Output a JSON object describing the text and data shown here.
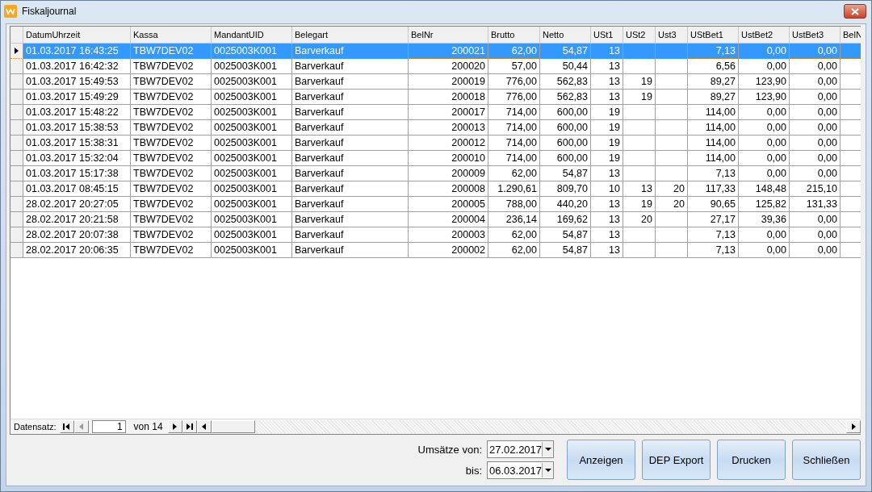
{
  "window": {
    "title": "Fiskaljournal"
  },
  "table": {
    "columns": [
      "DatumUhrzeit",
      "Kassa",
      "MandantUID",
      "Belegart",
      "BelNr",
      "Brutto",
      "Netto",
      "USt1",
      "USt2",
      "Ust3",
      "UStBet1",
      "UstBet2",
      "UstBet3",
      "BelN"
    ],
    "rows": [
      {
        "selected": true,
        "cells": [
          "01.03.2017 16:43:25",
          "TBW7DEV02",
          "0025003K001",
          "Barverkauf",
          "200021",
          "62,00",
          "54,87",
          "13",
          null,
          null,
          "7,13",
          "0,00",
          "0,00",
          null
        ]
      },
      {
        "selected": false,
        "cells": [
          "01.03.2017 16:42:32",
          "TBW7DEV02",
          "0025003K001",
          "Barverkauf",
          "200020",
          "57,00",
          "50,44",
          "13",
          null,
          null,
          "6,56",
          "0,00",
          "0,00",
          null
        ]
      },
      {
        "selected": false,
        "cells": [
          "01.03.2017 15:49:53",
          "TBW7DEV02",
          "0025003K001",
          "Barverkauf",
          "200019",
          "776,00",
          "562,83",
          "13",
          "19",
          null,
          "89,27",
          "123,90",
          "0,00",
          null
        ]
      },
      {
        "selected": false,
        "cells": [
          "01.03.2017 15:49:29",
          "TBW7DEV02",
          "0025003K001",
          "Barverkauf",
          "200018",
          "776,00",
          "562,83",
          "13",
          "19",
          null,
          "89,27",
          "123,90",
          "0,00",
          null
        ]
      },
      {
        "selected": false,
        "cells": [
          "01.03.2017 15:48:22",
          "TBW7DEV02",
          "0025003K001",
          "Barverkauf",
          "200017",
          "714,00",
          "600,00",
          "19",
          null,
          null,
          "114,00",
          "0,00",
          "0,00",
          null
        ]
      },
      {
        "selected": false,
        "cells": [
          "01.03.2017 15:38:53",
          "TBW7DEV02",
          "0025003K001",
          "Barverkauf",
          "200013",
          "714,00",
          "600,00",
          "19",
          null,
          null,
          "114,00",
          "0,00",
          "0,00",
          null
        ]
      },
      {
        "selected": false,
        "cells": [
          "01.03.2017 15:38:31",
          "TBW7DEV02",
          "0025003K001",
          "Barverkauf",
          "200012",
          "714,00",
          "600,00",
          "19",
          null,
          null,
          "114,00",
          "0,00",
          "0,00",
          null
        ]
      },
      {
        "selected": false,
        "cells": [
          "01.03.2017 15:32:04",
          "TBW7DEV02",
          "0025003K001",
          "Barverkauf",
          "200010",
          "714,00",
          "600,00",
          "19",
          null,
          null,
          "114,00",
          "0,00",
          "0,00",
          null
        ]
      },
      {
        "selected": false,
        "cells": [
          "01.03.2017 15:17:38",
          "TBW7DEV02",
          "0025003K001",
          "Barverkauf",
          "200009",
          "62,00",
          "54,87",
          "13",
          null,
          null,
          "7,13",
          "0,00",
          "0,00",
          null
        ]
      },
      {
        "selected": false,
        "cells": [
          "01.03.2017 08:45:15",
          "TBW7DEV02",
          "0025003K001",
          "Barverkauf",
          "200008",
          "1.290,61",
          "809,70",
          "10",
          "13",
          "20",
          "117,33",
          "148,48",
          "215,10",
          null
        ]
      },
      {
        "selected": false,
        "cells": [
          "28.02.2017 20:27:05",
          "TBW7DEV02",
          "0025003K001",
          "Barverkauf",
          "200005",
          "788,00",
          "440,20",
          "13",
          "19",
          "20",
          "90,65",
          "125,82",
          "131,33",
          null
        ]
      },
      {
        "selected": false,
        "cells": [
          "28.02.2017 20:21:58",
          "TBW7DEV02",
          "0025003K001",
          "Barverkauf",
          "200004",
          "236,14",
          "169,62",
          "13",
          "20",
          null,
          "27,17",
          "39,36",
          "0,00",
          null
        ]
      },
      {
        "selected": false,
        "cells": [
          "28.02.2017 20:07:38",
          "TBW7DEV02",
          "0025003K001",
          "Barverkauf",
          "200003",
          "62,00",
          "54,87",
          "13",
          null,
          null,
          "7,13",
          "0,00",
          "0,00",
          null
        ]
      },
      {
        "selected": false,
        "cells": [
          "28.02.2017 20:06:35",
          "TBW7DEV02",
          "0025003K001",
          "Barverkauf",
          "200002",
          "62,00",
          "54,87",
          "13",
          null,
          null,
          "7,13",
          "0,00",
          "0,00",
          null
        ]
      }
    ]
  },
  "navigator": {
    "label": "Datensatz:",
    "record": "1",
    "total": "von 14"
  },
  "filter": {
    "from_label": "Umsätze von:",
    "from_value": "27.02.2017",
    "to_label": "bis:",
    "to_value": "06.03.2017"
  },
  "buttons": [
    "Anzeigen",
    "DEP Export",
    "Drucken",
    "Schließen"
  ]
}
